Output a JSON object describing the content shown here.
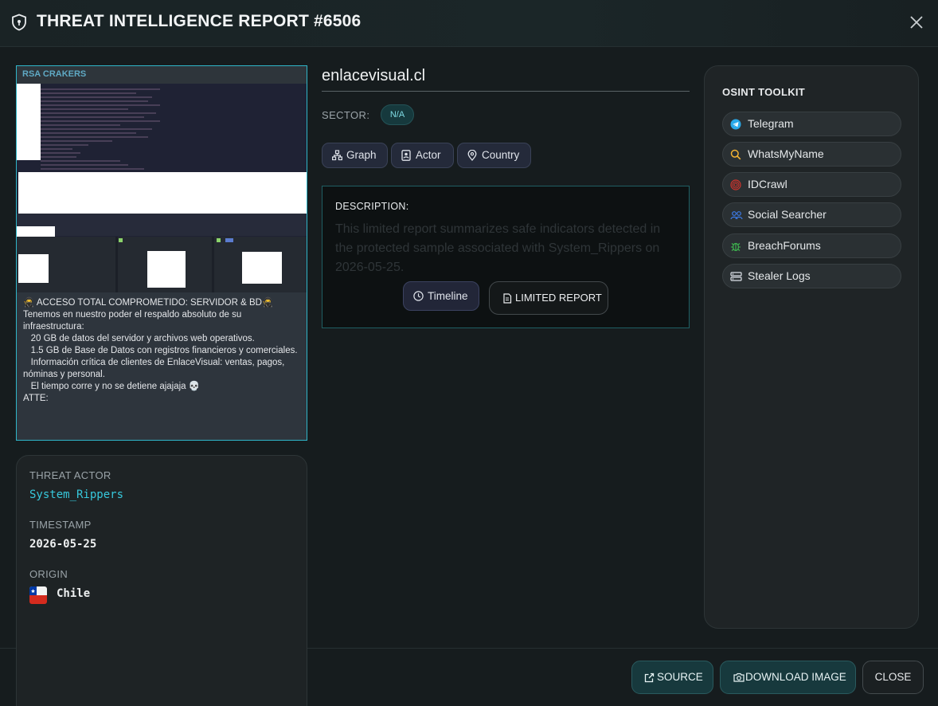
{
  "header": {
    "title": "THREAT INTELLIGENCE REPORT #6506"
  },
  "screenshot": {
    "channel_name": "RSA CRAKERS",
    "message_lines": [
      "🥷 ACCESO TOTAL COMPROMETIDO: SERVIDOR & BD🥷",
      "Tenemos en nuestro poder el respaldo absoluto de su infraestructura:",
      "",
      "   20 GB de datos del servidor y archivos web operativos.",
      "",
      "   1.5 GB de Base de Datos con registros financieros y comerciales.",
      "",
      "   Información crítica de clientes de EnlaceVisual: ventas, pagos, nóminas y personal.",
      "   El tiempo corre y no se detiene ajajaja 💀",
      "ATTE:"
    ]
  },
  "details": {
    "threat_actor_label": "THREAT ACTOR",
    "threat_actor": "System_Rippers",
    "timestamp_label": "TIMESTAMP",
    "timestamp": "2026-05-25",
    "origin_label": "ORIGIN",
    "origin": "Chile"
  },
  "report": {
    "domain": "enlacevisual.cl",
    "sector_label": "SECTOR:",
    "sector": "N/A",
    "pills": {
      "graph": "Graph",
      "actor": "Actor",
      "country": "Country"
    },
    "description_label": "DESCRIPTION:",
    "description": "This limited report summarizes safe indicators detected in the protected sample associated with System_Rippers on 2026-05-25.",
    "timeline_label": "Timeline",
    "limited_report_label": "LIMITED REPORT"
  },
  "osint": {
    "title": "OSINT TOOLKIT",
    "tools": [
      "Telegram",
      "WhatsMyName",
      "IDCrawl",
      "Social Searcher",
      "BreachForums",
      "Stealer Logs"
    ]
  },
  "footer": {
    "source_label": "SOURCE",
    "download_label": "DOWNLOAD IMAGE",
    "close_label": "CLOSE"
  },
  "colors": {
    "accent": "#37c8dc",
    "teal_button": "#17393d",
    "panel": "#1f2426"
  }
}
